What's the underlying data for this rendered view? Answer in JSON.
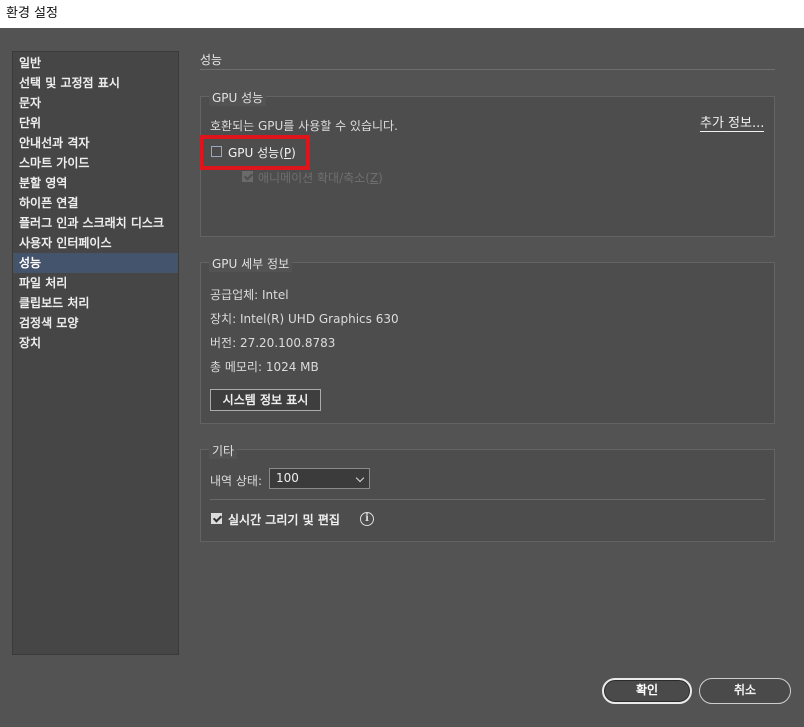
{
  "window": {
    "title": "환경 설정"
  },
  "sidebar": {
    "items": [
      {
        "label": "일반"
      },
      {
        "label": "선택 및 고정점 표시"
      },
      {
        "label": "문자"
      },
      {
        "label": "단위"
      },
      {
        "label": "안내선과 격자"
      },
      {
        "label": "스마트 가이드"
      },
      {
        "label": "분할 영역"
      },
      {
        "label": "하이픈 연결"
      },
      {
        "label": "플러그 인과 스크래치 디스크"
      },
      {
        "label": "사용자 인터페이스"
      },
      {
        "label": "성능",
        "selected": true
      },
      {
        "label": "파일 처리"
      },
      {
        "label": "클립보드 처리"
      },
      {
        "label": "검정색 모양"
      },
      {
        "label": "장치"
      }
    ]
  },
  "main": {
    "section_title": "성능",
    "gpu_performance": {
      "group_label": "GPU 성능",
      "description": "호환되는 GPU를 사용할 수 있습니다.",
      "more_info_link": "추가 정보...",
      "gpu_checkbox": {
        "label": "GPU 성능",
        "mnemonic": "P",
        "checked": false
      },
      "animated_zoom_checkbox": {
        "label": "애니메이션 확대/축소",
        "mnemonic": "Z",
        "checked": true,
        "disabled": true
      }
    },
    "gpu_details": {
      "group_label": "GPU 세부 정보",
      "vendor": "공급업체: Intel",
      "device": "장치: Intel(R) UHD Graphics 630",
      "version": "버전: 27.20.100.8783",
      "total_memory": "총 메모리: 1024 MB",
      "system_info_button": "시스템 정보 표시"
    },
    "other": {
      "group_label": "기타",
      "history_states_label": "내역 상태:",
      "history_states_value": "100",
      "live_drawing_checkbox": {
        "label": "실시간 그리기 및 편집",
        "checked": true
      }
    }
  },
  "footer": {
    "ok_label": "확인",
    "cancel_label": "취소"
  },
  "colors": {
    "background": "#535353",
    "selected_item": "#44546c",
    "highlight_box": "#e0141b"
  }
}
